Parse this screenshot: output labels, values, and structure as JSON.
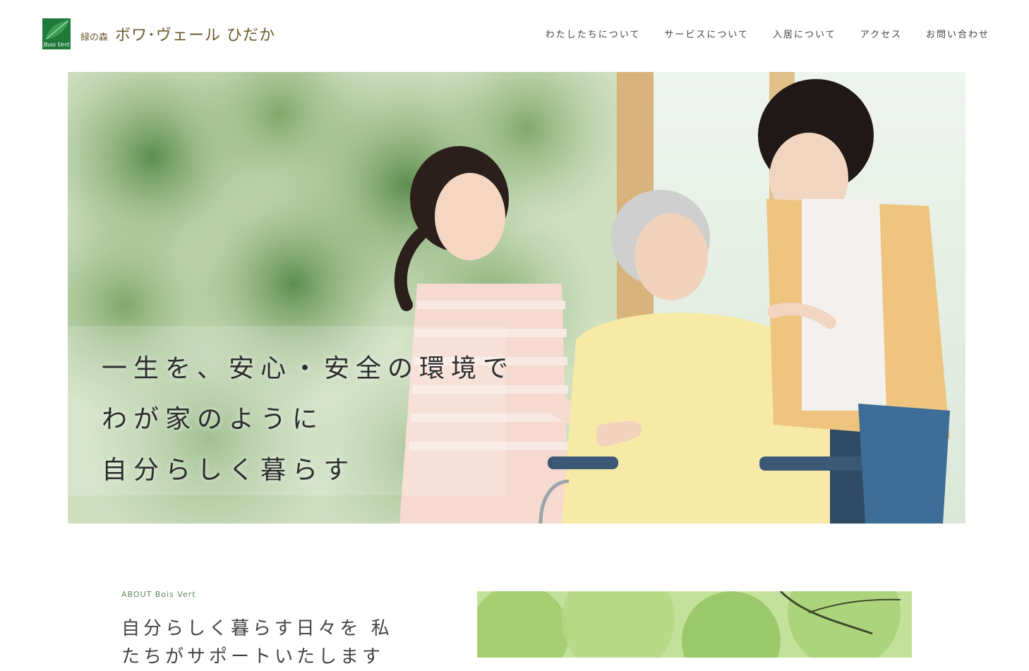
{
  "brand": {
    "mark_text": "Bois Vert",
    "subtitle": "緑の森",
    "name": "ボワ･ヴェール ひだか"
  },
  "nav": {
    "items": [
      "わたしたちについて",
      "サービスについて",
      "入居について",
      "アクセス",
      "お問い合わせ"
    ]
  },
  "hero": {
    "lines": [
      "一生を、安心・安全の環境で",
      "わが家のように",
      "自分らしく暮らす"
    ]
  },
  "about": {
    "label": "ABOUT Bois Vert",
    "heading": "自分らしく暮らす日々を 私たちがサポートいたします"
  },
  "colors": {
    "brand_green": "#1f7a3a",
    "brand_text": "#6b5a2a",
    "label_green": "#5a8a55"
  }
}
